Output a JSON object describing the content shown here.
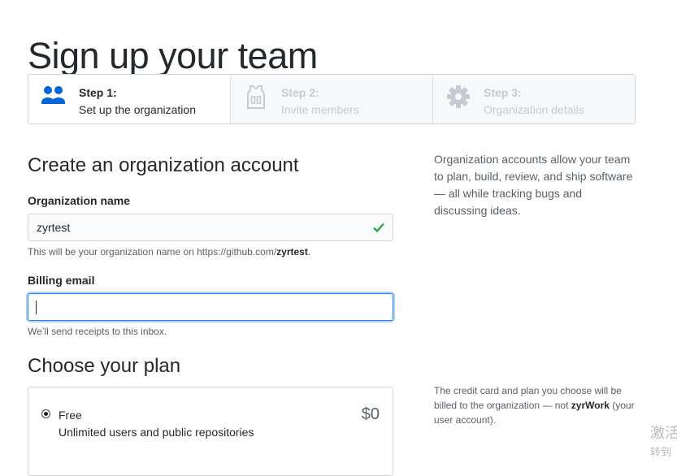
{
  "page": {
    "title": "Sign up your team"
  },
  "steps": [
    {
      "number": "Step 1:",
      "description": "Set up the organization",
      "icon": "people-icon",
      "active": true
    },
    {
      "number": "Step 2:",
      "description": "Invite members",
      "icon": "jersey-icon",
      "active": false
    },
    {
      "number": "Step 3:",
      "description": "Organization details",
      "icon": "gear-icon",
      "active": false
    }
  ],
  "org_form": {
    "section_title": "Create an organization account",
    "name_label": "Organization name",
    "name_value": "zyrtest",
    "name_note_prefix": "This will be your organization name on https://github.com/",
    "name_note_handle": "zyrtest",
    "name_note_suffix": ".",
    "email_label": "Billing email",
    "email_value": "",
    "email_note": "We’ll send receipts to this inbox."
  },
  "sidebar": {
    "org_info": "Organization accounts allow your team to plan, build, review, and ship software — all while tracking bugs and discussing ideas.",
    "billing_prefix": "The credit card and plan you choose will be billed to the organization — not ",
    "billing_user": "zyrWork",
    "billing_suffix": " (your user account)."
  },
  "plan": {
    "section_title": "Choose your plan",
    "options": [
      {
        "name": "Free",
        "description": "Unlimited users and public repositories",
        "price": "$0",
        "selected": true
      }
    ]
  },
  "watermark": {
    "line1": "激活",
    "line2": "转到"
  },
  "colors": {
    "valid_check": "#28a745",
    "focus_border": "#2188ff",
    "active_icon": "#0366d6",
    "inactive_icon": "#c6cbd1"
  }
}
